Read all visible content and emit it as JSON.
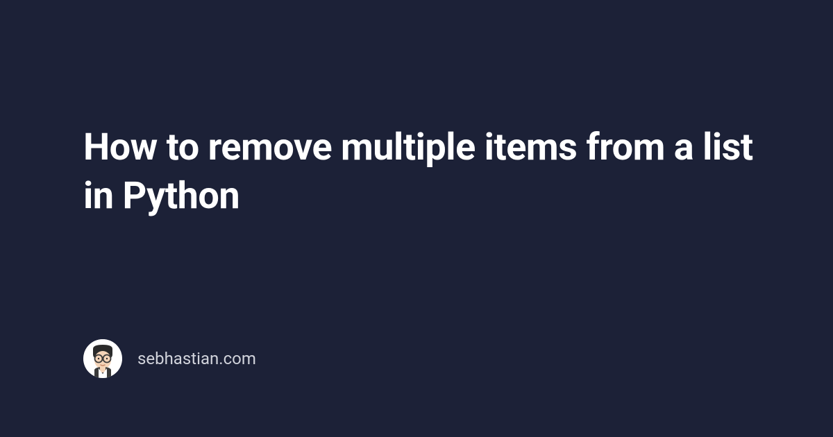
{
  "title": "How to remove multiple items from a list in Python",
  "footer": {
    "site_name": "sebhastian.com"
  }
}
